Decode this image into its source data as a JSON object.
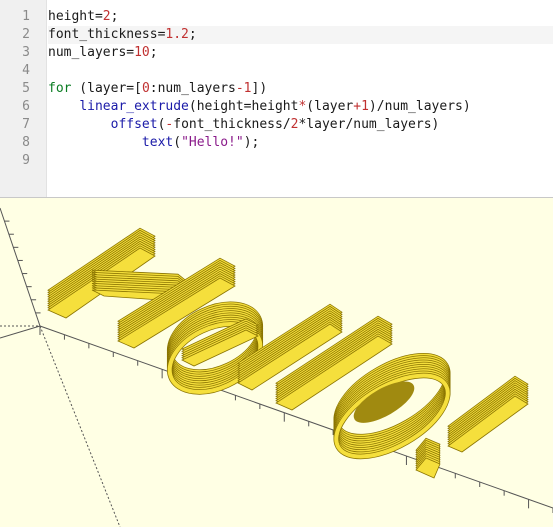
{
  "editor": {
    "line_numbers": [
      "1",
      "2",
      "3",
      "4",
      "5",
      "6",
      "7",
      "8",
      "9"
    ],
    "lines": [
      {
        "tokens": [
          {
            "t": "height=",
            "c": "pl"
          },
          {
            "t": "2",
            "c": "num"
          },
          {
            "t": ";",
            "c": "pl"
          }
        ]
      },
      {
        "tokens": [
          {
            "t": "font_thickness=",
            "c": "pl"
          },
          {
            "t": "1.2",
            "c": "num"
          },
          {
            "t": ";",
            "c": "pl"
          }
        ],
        "current": true
      },
      {
        "tokens": [
          {
            "t": "num_layers=",
            "c": "pl"
          },
          {
            "t": "10",
            "c": "num"
          },
          {
            "t": ";",
            "c": "pl"
          }
        ]
      },
      {
        "tokens": []
      },
      {
        "tokens": [
          {
            "t": "for",
            "c": "kw"
          },
          {
            "t": " (layer=[",
            "c": "pl"
          },
          {
            "t": "0",
            "c": "num"
          },
          {
            "t": ":num_layers",
            "c": "pl"
          },
          {
            "t": "-1",
            "c": "op"
          },
          {
            "t": "])",
            "c": "pl"
          }
        ]
      },
      {
        "tokens": [
          {
            "t": "    ",
            "c": "pl"
          },
          {
            "t": "linear_extrude",
            "c": "fn"
          },
          {
            "t": "(height=height",
            "c": "pl"
          },
          {
            "t": "*",
            "c": "op"
          },
          {
            "t": "(layer",
            "c": "pl"
          },
          {
            "t": "+1",
            "c": "op"
          },
          {
            "t": ")/num_layers)",
            "c": "pl"
          }
        ]
      },
      {
        "tokens": [
          {
            "t": "        ",
            "c": "pl"
          },
          {
            "t": "offset",
            "c": "fn"
          },
          {
            "t": "(",
            "c": "pl"
          },
          {
            "t": "-",
            "c": "op"
          },
          {
            "t": "font_thickness/",
            "c": "pl"
          },
          {
            "t": "2",
            "c": "num"
          },
          {
            "t": "*layer/num_layers)",
            "c": "pl"
          }
        ]
      },
      {
        "tokens": [
          {
            "t": "            ",
            "c": "pl"
          },
          {
            "t": "text",
            "c": "fn"
          },
          {
            "t": "(",
            "c": "pl"
          },
          {
            "t": "\"Hello!\"",
            "c": "str"
          },
          {
            "t": ");",
            "c": "pl"
          }
        ]
      },
      {
        "tokens": []
      }
    ]
  },
  "viewport": {
    "background": "#ffffe4",
    "model_fill": "#f5df3c",
    "model_edge": "#8a7400",
    "axis_color": "#555555"
  }
}
